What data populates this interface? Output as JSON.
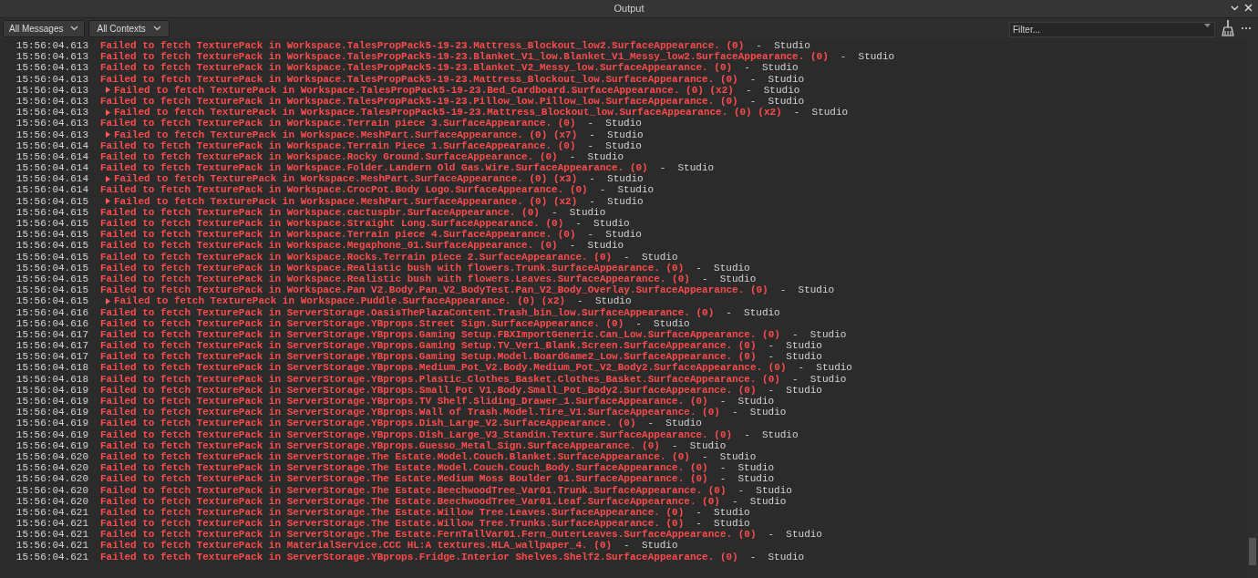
{
  "window": {
    "title": "Output"
  },
  "toolbar": {
    "message_filter": "All Messages",
    "context_filter": "All Contexts",
    "filter": {
      "placeholder": "Filter..."
    }
  },
  "lines": [
    {
      "time": "15:56:04.613",
      "collapsible": false,
      "message": "Failed to fetch TexturePack in Workspace.TalesPropPack5-19-23.Mattress_Blockout_low2.SurfaceAppearance. (0)",
      "source": "-  Studio"
    },
    {
      "time": "15:56:04.613",
      "collapsible": false,
      "message": "Failed to fetch TexturePack in Workspace.TalesPropPack5-19-23.Blanket_V1_low.Blanket_V1_Messy_low2.SurfaceAppearance. (0)",
      "source": "-  Studio"
    },
    {
      "time": "15:56:04.613",
      "collapsible": false,
      "message": "Failed to fetch TexturePack in Workspace.TalesPropPack5-19-23.Blanket_V2_Messy_low.SurfaceAppearance. (0)",
      "source": "-  Studio"
    },
    {
      "time": "15:56:04.613",
      "collapsible": false,
      "message": "Failed to fetch TexturePack in Workspace.TalesPropPack5-19-23.Mattress_Blockout_low.SurfaceAppearance. (0)",
      "source": "-  Studio"
    },
    {
      "time": "15:56:04.613",
      "collapsible": true,
      "message": "Failed to fetch TexturePack in Workspace.TalesPropPack5-19-23.Bed_Cardboard.SurfaceAppearance. (0) (x2)",
      "source": "-  Studio"
    },
    {
      "time": "15:56:04.613",
      "collapsible": false,
      "message": "Failed to fetch TexturePack in Workspace.TalesPropPack5-19-23.Pillow_low.Pillow_low.SurfaceAppearance. (0)",
      "source": "-  Studio"
    },
    {
      "time": "15:56:04.613",
      "collapsible": true,
      "message": "Failed to fetch TexturePack in Workspace.TalesPropPack5-19-23.Mattress_Blockout_low.SurfaceAppearance. (0) (x2)",
      "source": "-  Studio"
    },
    {
      "time": "15:56:04.613",
      "collapsible": false,
      "message": "Failed to fetch TexturePack in Workspace.Terrain piece 3.SurfaceAppearance. (0)",
      "source": "-  Studio"
    },
    {
      "time": "15:56:04.613",
      "collapsible": true,
      "message": "Failed to fetch TexturePack in Workspace.MeshPart.SurfaceAppearance. (0) (x7)",
      "source": "-  Studio"
    },
    {
      "time": "15:56:04.614",
      "collapsible": false,
      "message": "Failed to fetch TexturePack in Workspace.Terrain Piece 1.SurfaceAppearance. (0)",
      "source": "-  Studio"
    },
    {
      "time": "15:56:04.614",
      "collapsible": false,
      "message": "Failed to fetch TexturePack in Workspace.Rocky Ground.SurfaceAppearance. (0)",
      "source": "-  Studio"
    },
    {
      "time": "15:56:04.614",
      "collapsible": false,
      "message": "Failed to fetch TexturePack in Workspace.Folder.Landern Old Gas.Wire.SurfaceAppearance. (0)",
      "source": "-  Studio"
    },
    {
      "time": "15:56:04.614",
      "collapsible": true,
      "message": "Failed to fetch TexturePack in Workspace.MeshPart.SurfaceAppearance. (0) (x3)",
      "source": "-  Studio"
    },
    {
      "time": "15:56:04.614",
      "collapsible": false,
      "message": "Failed to fetch TexturePack in Workspace.CrocPot.Body Logo.SurfaceAppearance. (0)",
      "source": "-  Studio"
    },
    {
      "time": "15:56:04.615",
      "collapsible": true,
      "message": "Failed to fetch TexturePack in Workspace.MeshPart.SurfaceAppearance. (0) (x2)",
      "source": "-  Studio"
    },
    {
      "time": "15:56:04.615",
      "collapsible": false,
      "message": "Failed to fetch TexturePack in Workspace.cactuspbr.SurfaceAppearance. (0)",
      "source": "-  Studio"
    },
    {
      "time": "15:56:04.615",
      "collapsible": false,
      "message": "Failed to fetch TexturePack in Workspace.Straight Long.SurfaceAppearance. (0)",
      "source": "-  Studio"
    },
    {
      "time": "15:56:04.615",
      "collapsible": false,
      "message": "Failed to fetch TexturePack in Workspace.Terrain piece 4.SurfaceAppearance. (0)",
      "source": "-  Studio"
    },
    {
      "time": "15:56:04.615",
      "collapsible": false,
      "message": "Failed to fetch TexturePack in Workspace.Megaphone_01.SurfaceAppearance. (0)",
      "source": "-  Studio"
    },
    {
      "time": "15:56:04.615",
      "collapsible": false,
      "message": "Failed to fetch TexturePack in Workspace.Rocks.Terrain piece 2.SurfaceAppearance. (0)",
      "source": "-  Studio"
    },
    {
      "time": "15:56:04.615",
      "collapsible": false,
      "message": "Failed to fetch TexturePack in Workspace.Realistic bush with flowers.Trunk.SurfaceAppearance. (0)",
      "source": "-  Studio"
    },
    {
      "time": "15:56:04.615",
      "collapsible": false,
      "message": "Failed to fetch TexturePack in Workspace.Realistic bush with flowers.Leaves.SurfaceAppearance. (0)",
      "source": "-  Studio"
    },
    {
      "time": "15:56:04.615",
      "collapsible": false,
      "message": "Failed to fetch TexturePack in Workspace.Pan V2.Body.Pan_V2_BodyTest.Pan_V2_Body_Overlay.SurfaceAppearance. (0)",
      "source": "-  Studio"
    },
    {
      "time": "15:56:04.615",
      "collapsible": true,
      "message": "Failed to fetch TexturePack in Workspace.Puddle.SurfaceAppearance. (0) (x2)",
      "source": "-  Studio"
    },
    {
      "time": "15:56:04.616",
      "collapsible": false,
      "message": "Failed to fetch TexturePack in ServerStorage.OasisThePlazaContent.Trash_bin_low.SurfaceAppearance. (0)",
      "source": "-  Studio"
    },
    {
      "time": "15:56:04.616",
      "collapsible": false,
      "message": "Failed to fetch TexturePack in ServerStorage.YBprops.Street Sign.SurfaceAppearance. (0)",
      "source": "-  Studio"
    },
    {
      "time": "15:56:04.617",
      "collapsible": false,
      "message": "Failed to fetch TexturePack in ServerStorage.YBprops.Gaming Setup.FBXImportGeneric.Can_Low.SurfaceAppearance. (0)",
      "source": "-  Studio"
    },
    {
      "time": "15:56:04.617",
      "collapsible": false,
      "message": "Failed to fetch TexturePack in ServerStorage.YBprops.Gaming Setup.TV_Ver1_Blank.Screen.SurfaceAppearance. (0)",
      "source": "-  Studio"
    },
    {
      "time": "15:56:04.617",
      "collapsible": false,
      "message": "Failed to fetch TexturePack in ServerStorage.YBprops.Gaming Setup.Model.BoardGame2_Low.SurfaceAppearance. (0)",
      "source": "-  Studio"
    },
    {
      "time": "15:56:04.618",
      "collapsible": false,
      "message": "Failed to fetch TexturePack in ServerStorage.YBprops.Medium_Pot_V2.Body.Medium_Pot_V2_Body2.SurfaceAppearance. (0)",
      "source": "-  Studio"
    },
    {
      "time": "15:56:04.618",
      "collapsible": false,
      "message": "Failed to fetch TexturePack in ServerStorage.YBprops.Plastic_Clothes_Basket.Clothes_Basket.SurfaceAppearance. (0)",
      "source": "-  Studio"
    },
    {
      "time": "15:56:04.619",
      "collapsible": false,
      "message": "Failed to fetch TexturePack in ServerStorage.YBprops.Small Pot V1.Body.Small_Pot_Body2.SurfaceAppearance. (0)",
      "source": "-  Studio"
    },
    {
      "time": "15:56:04.619",
      "collapsible": false,
      "message": "Failed to fetch TexturePack in ServerStorage.YBprops.TV Shelf.Sliding_Drawer_1.SurfaceAppearance. (0)",
      "source": "-  Studio"
    },
    {
      "time": "15:56:04.619",
      "collapsible": false,
      "message": "Failed to fetch TexturePack in ServerStorage.YBprops.Wall of Trash.Model.Tire_V1.SurfaceAppearance. (0)",
      "source": "-  Studio"
    },
    {
      "time": "15:56:04.619",
      "collapsible": false,
      "message": "Failed to fetch TexturePack in ServerStorage.YBprops.Dish_Large_V2.SurfaceAppearance. (0)",
      "source": "-  Studio"
    },
    {
      "time": "15:56:04.619",
      "collapsible": false,
      "message": "Failed to fetch TexturePack in ServerStorage.YBprops.Dish_Large_V3_Standin.Texture.SurfaceAppearance. (0)",
      "source": "-  Studio"
    },
    {
      "time": "15:56:04.619",
      "collapsible": false,
      "message": "Failed to fetch TexturePack in ServerStorage.YBprops.Guesso_Metal_Sign.SurfaceAppearance. (0)",
      "source": "-  Studio"
    },
    {
      "time": "15:56:04.620",
      "collapsible": false,
      "message": "Failed to fetch TexturePack in ServerStorage.The Estate.Model.Couch.Blanket.SurfaceAppearance. (0)",
      "source": "-  Studio"
    },
    {
      "time": "15:56:04.620",
      "collapsible": false,
      "message": "Failed to fetch TexturePack in ServerStorage.The Estate.Model.Couch.Couch_Body.SurfaceAppearance. (0)",
      "source": "-  Studio"
    },
    {
      "time": "15:56:04.620",
      "collapsible": false,
      "message": "Failed to fetch TexturePack in ServerStorage.The Estate.Medium Moss Boulder 01.SurfaceAppearance. (0)",
      "source": "-  Studio"
    },
    {
      "time": "15:56:04.620",
      "collapsible": false,
      "message": "Failed to fetch TexturePack in ServerStorage.The Estate.BeechwoodTree_Var01.Trunk.SurfaceAppearance. (0)",
      "source": "-  Studio"
    },
    {
      "time": "15:56:04.620",
      "collapsible": false,
      "message": "Failed to fetch TexturePack in ServerStorage.The Estate.BeechwoodTree_Var01.Leaf.SurfaceAppearance. (0)",
      "source": "-  Studio"
    },
    {
      "time": "15:56:04.621",
      "collapsible": false,
      "message": "Failed to fetch TexturePack in ServerStorage.The Estate.Willow Tree.Leaves.SurfaceAppearance. (0)",
      "source": "-  Studio"
    },
    {
      "time": "15:56:04.621",
      "collapsible": false,
      "message": "Failed to fetch TexturePack in ServerStorage.The Estate.Willow Tree.Trunks.SurfaceAppearance. (0)",
      "source": "-  Studio"
    },
    {
      "time": "15:56:04.621",
      "collapsible": false,
      "message": "Failed to fetch TexturePack in ServerStorage.The Estate.FernTallVar01.Fern_OuterLeaves.SurfaceAppearance. (0)",
      "source": "-  Studio"
    },
    {
      "time": "15:56:04.621",
      "collapsible": false,
      "message": "Failed to fetch TexturePack in MaterialService.CCC HL:A textures.HLA_wallpaper_4. (0)",
      "source": "-  Studio"
    },
    {
      "time": "15:56:04.621",
      "collapsible": false,
      "message": "Failed to fetch TexturePack in ServerStorage.YBprops.Fridge.Interior Shelves.Shelf2.SurfaceAppearance. (0)",
      "source": "-  Studio"
    }
  ]
}
